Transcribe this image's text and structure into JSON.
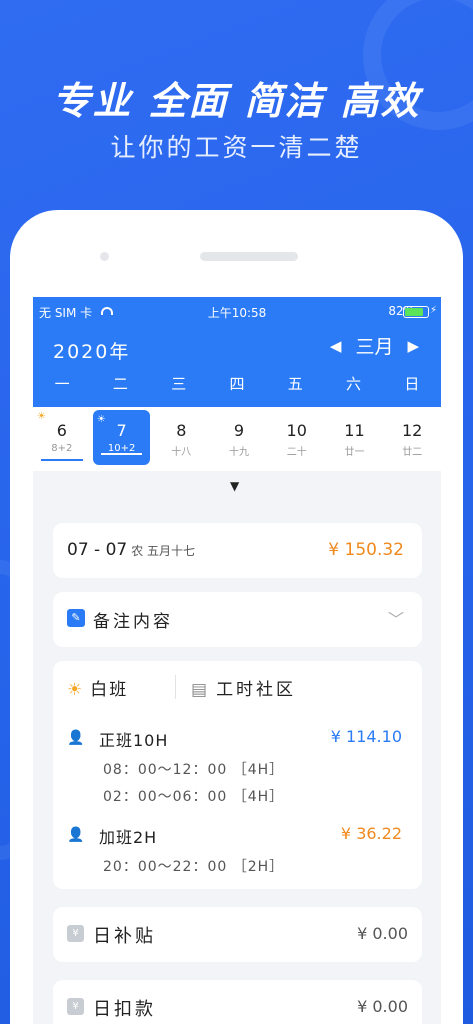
{
  "banner": {
    "slogan": [
      "专业",
      "全面",
      "简洁",
      "高效"
    ],
    "subtitle": "让你的工资一清二楚"
  },
  "status_bar": {
    "carrier": "无 SIM 卡",
    "time": "上午10:58",
    "battery": "82%"
  },
  "calendar": {
    "year": "2020年",
    "month": "三月",
    "weekdays": [
      "一",
      "二",
      "三",
      "四",
      "五",
      "六",
      "日"
    ],
    "days": [
      {
        "num": "6",
        "sub": "8+2"
      },
      {
        "num": "7",
        "sub": "10+2"
      },
      {
        "num": "8",
        "sub": "十八"
      },
      {
        "num": "9",
        "sub": "十九"
      },
      {
        "num": "10",
        "sub": "二十"
      },
      {
        "num": "11",
        "sub": "廿一"
      },
      {
        "num": "12",
        "sub": "廿二"
      }
    ]
  },
  "summary": {
    "date": "07 - 07",
    "lunar": "农 五月十七",
    "amount": "¥ 150.32"
  },
  "note": {
    "label": "备注内容"
  },
  "shift": {
    "tab_day": "白班",
    "tab_community": "工时社区",
    "regular": {
      "label": "正班10H",
      "amount": "¥ 114.10",
      "times": [
        "08：00～12：00 ［4H］",
        "02：00～06：00 ［4H］"
      ]
    },
    "overtime": {
      "label": "加班2H",
      "amount": "¥ 36.22",
      "times": [
        "20：00～22：00 ［2H］"
      ]
    }
  },
  "allowance": {
    "label": "日补贴",
    "amount": "¥ 0.00"
  },
  "deduction": {
    "label": "日扣款",
    "amount": "¥ 0.00"
  },
  "colors": {
    "primary": "#2a7bf5",
    "orange": "#f08a1e"
  }
}
